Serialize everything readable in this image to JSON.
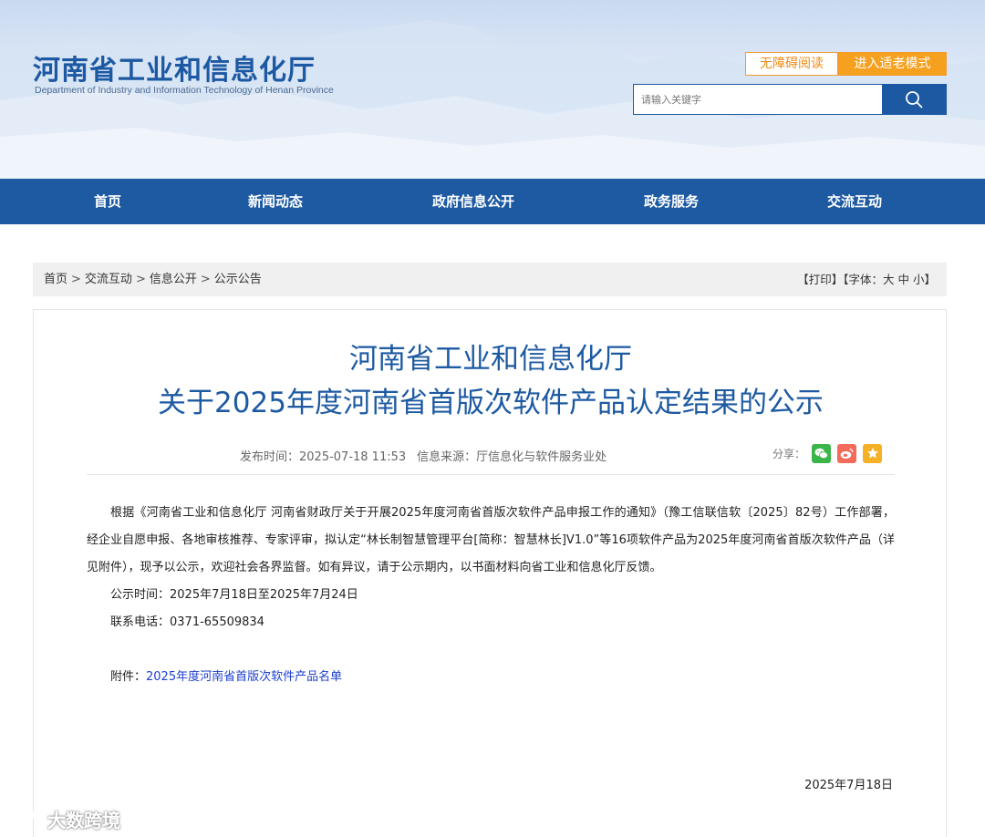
{
  "header": {
    "site_title": "河南省工业和信息化厅",
    "site_subtitle": "Department of Industry and Information Technology of Henan Province",
    "accessible_label": "无障碍阅读",
    "elder_mode_label": "进入适老模式",
    "search_placeholder": "请输入关键字",
    "search_icon": "search-icon"
  },
  "nav": {
    "items": [
      {
        "label": "首页"
      },
      {
        "label": "新闻动态"
      },
      {
        "label": "政府信息公开"
      },
      {
        "label": "政务服务"
      },
      {
        "label": "交流互动"
      }
    ]
  },
  "breadcrumb": {
    "items": [
      "首页",
      "交流互动",
      "信息公开",
      "公示公告"
    ],
    "separator": ">"
  },
  "tools": {
    "print": "【打印】",
    "font_prefix": "【字体：",
    "font_large": "大",
    "font_medium": "中",
    "font_small": "小",
    "font_suffix": "】"
  },
  "article": {
    "title_line1": "河南省工业和信息化厅",
    "title_line2": "关于2025年度河南省首版次软件产品认定结果的公示",
    "publish_time": "发布时间：2025-07-18 11:53",
    "source": "信息来源：厅信息化与软件服务业处",
    "share_label": "分享：",
    "share_icons": [
      "wechat-icon",
      "weibo-icon",
      "favorite-icon"
    ],
    "paragraph1": "根据《河南省工业和信息化厅 河南省财政厅关于开展2025年度河南省首版次软件产品申报工作的通知》（豫工信联信软〔2025〕82号）工作部署，经企业自愿申报、各地审核推荐、专家评审，拟认定“林长制智慧管理平台[简称：智慧林长]V1.0”等16项软件产品为2025年度河南省首版次软件产品（详见附件），现予以公示，欢迎社会各界监督。如有异议，请于公示期内，以书面材料向省工业和信息化厅反馈。",
    "notice_period": "公示时间：2025年7月18日至2025年7月24日",
    "contact_phone": "联系电话：0371-65509834",
    "attachment_prefix": "附件：",
    "attachment_link": "2025年度河南省首版次软件产品名单",
    "sign_date": "2025年7月18日"
  },
  "watermark": {
    "text": "大数跨境"
  },
  "colors": {
    "brand_blue": "#1d5aa2",
    "accent_orange": "#f5a11f",
    "link_blue": "#1d3fd0"
  }
}
